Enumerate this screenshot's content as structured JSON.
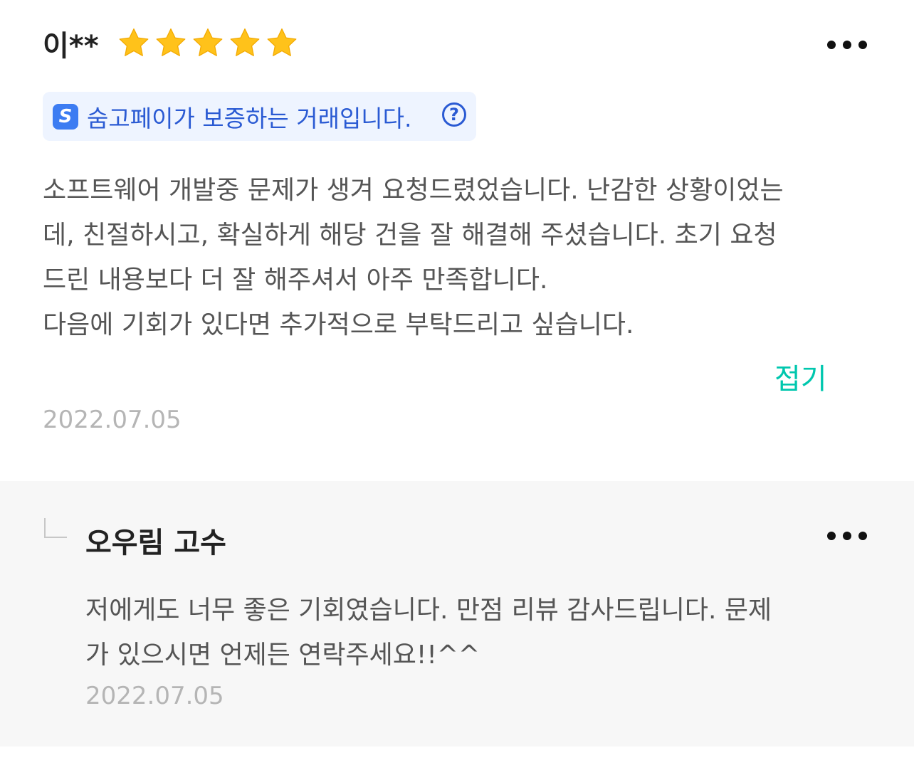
{
  "review": {
    "reviewer": "이**",
    "rating": 5,
    "rating_max": 5,
    "star_color": "#ffc21a",
    "more_icon": "more-horizontal-icon",
    "pay_badge": {
      "logo": "S",
      "text": "숨고페이가 보증하는 거래입니다.",
      "help_icon_glyph": "?",
      "color": "#2a5ad3",
      "background": "#eef4ff"
    },
    "body_lines": [
      "소프트웨어 개발중 문제가 생겨 요청드렸었습니다. 난감한 상황이었는",
      "데, 친절하시고, 확실하게 해당 건을 잘 해결해 주셨습니다. 초기 요청",
      "드린 내용보다 더 잘 해주셔서 아주 만족합니다.",
      "다음에 기회가 있다면 추가적으로 부탁드리고 싶습니다."
    ],
    "collapse_label": "접기",
    "accent_color": "#00c7ae",
    "date": "2022.07.05"
  },
  "reply": {
    "author": "오우림 고수",
    "more_icon": "more-horizontal-icon",
    "body_lines": [
      "저에게도 너무 좋은 기회였습니다. 만점 리뷰 감사드립니다. 문제",
      "가 있으시면 언제든 연락주세요!!^^"
    ],
    "date": "2022.07.05"
  }
}
